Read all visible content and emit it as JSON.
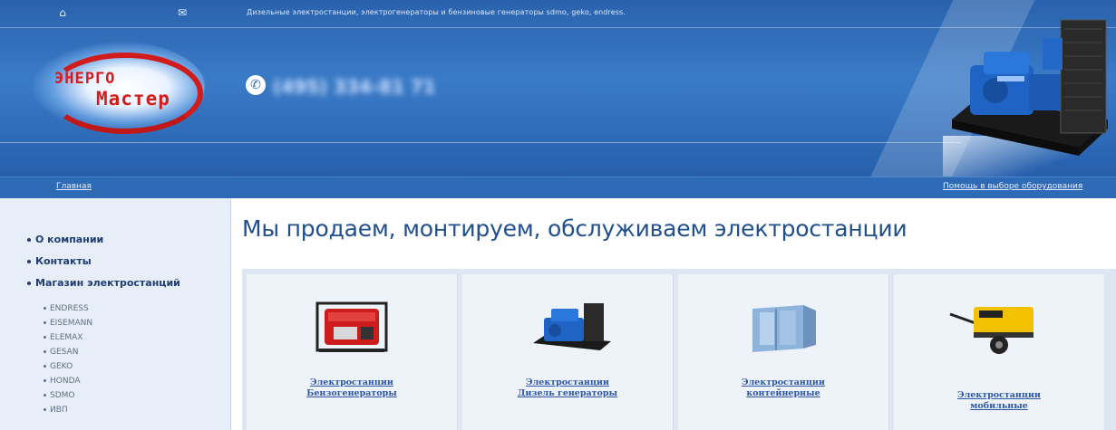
{
  "header": {
    "tagline": "Дизельные электростанции, электрогенераторы и бензиновые генераторы sdmo, geko, endress.",
    "logo_line1": "ЭНЕРГО",
    "logo_line2": "Мастер",
    "phone": "(495) 334-81 71"
  },
  "nav": {
    "home": "Главная",
    "help": "Помощь в выборе оборудования"
  },
  "sidebar": {
    "main_items": [
      "О компании",
      "Контакты",
      "Магазин электростанций"
    ],
    "brands": [
      "ENDRESS",
      "EISEMANN",
      "ELEMAX",
      "GESAN",
      "GEKO",
      "HONDA",
      "SDMO",
      "ИВП"
    ]
  },
  "content": {
    "heading": "Мы продаем, монтируем, обслуживаем электростанции",
    "categories": [
      {
        "line1": "Электростанции",
        "line2": "Бензогенераторы",
        "image": "petrol-generator"
      },
      {
        "line1": "Электростанции",
        "line2": "Дизель генераторы",
        "image": "diesel-generator"
      },
      {
        "line1": "Электростанции",
        "line2": "контейнерные",
        "image": "container-station"
      },
      {
        "line1": "Электростанции",
        "line2": "мобильные",
        "image": "mobile-trailer-generator"
      }
    ]
  },
  "colors": {
    "header_blue": "#2f6cb9",
    "nav_blue": "#2f6ab7",
    "heading_blue": "#1f4f8c",
    "link_blue": "#2d56a5",
    "logo_red": "#d41c1c"
  }
}
